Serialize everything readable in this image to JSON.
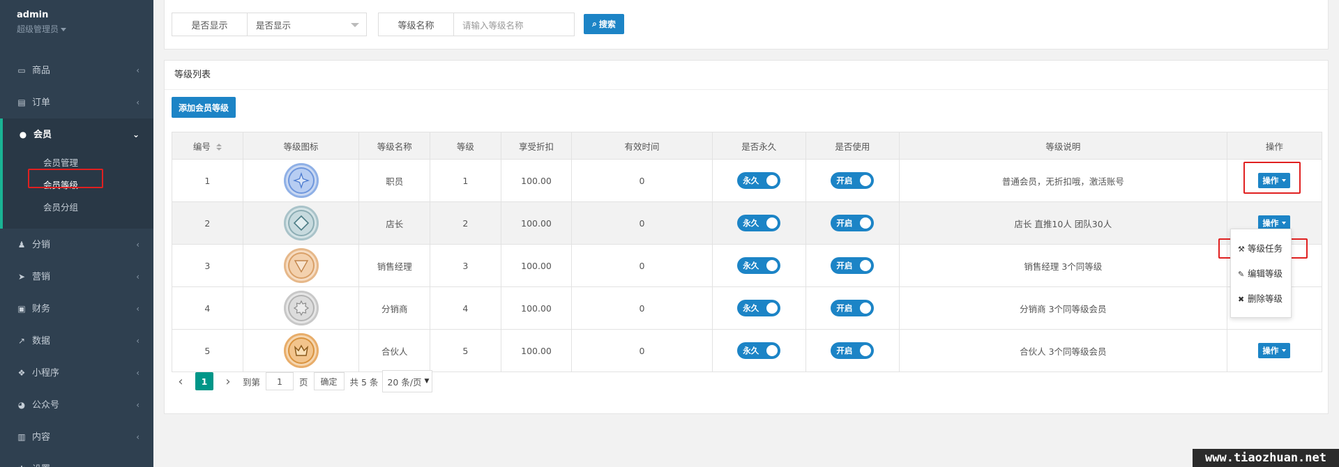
{
  "user": {
    "name": "admin",
    "role": "超级管理员"
  },
  "sidebar": {
    "items": [
      {
        "icon": "laptop-icon",
        "glyph": "▭",
        "label": "商品"
      },
      {
        "icon": "document-icon",
        "glyph": "▤",
        "label": "订单"
      },
      {
        "icon": "user-icon",
        "glyph": "●",
        "label": "会员",
        "active": true
      },
      {
        "icon": "users-icon",
        "glyph": "♟",
        "label": "分销"
      },
      {
        "icon": "paper-plane-icon",
        "glyph": "➤",
        "label": "营销"
      },
      {
        "icon": "money-icon",
        "glyph": "▣",
        "label": "财务"
      },
      {
        "icon": "line-chart-icon",
        "glyph": "↗",
        "label": "数据"
      },
      {
        "icon": "cubes-icon",
        "glyph": "❖",
        "label": "小程序"
      },
      {
        "icon": "wechat-icon",
        "glyph": "◕",
        "label": "公众号"
      },
      {
        "icon": "book-icon",
        "glyph": "▥",
        "label": "内容"
      },
      {
        "icon": "gear-icon",
        "glyph": "✱",
        "label": "设置"
      }
    ],
    "sub_items": [
      "会员管理",
      "会员等级",
      "会员分组"
    ]
  },
  "filters": {
    "display_label": "是否显示",
    "display_value": "是否显示",
    "name_label": "等级名称",
    "name_placeholder": "请输入等级名称",
    "search_label": "搜索"
  },
  "list": {
    "title": "等级列表",
    "add_label": "添加会员等级",
    "columns": [
      "编号",
      "等级图标",
      "等级名称",
      "等级",
      "享受折扣",
      "有效时间",
      "是否永久",
      "是否使用",
      "等级说明",
      "操作"
    ],
    "rows": [
      {
        "id": "1",
        "icon": "star-badge-icon",
        "name": "职员",
        "level": "1",
        "discount": "100.00",
        "valid": "0",
        "permanent": "永久",
        "enabled": "开启",
        "desc": "普通会员，无折扣哦，激活账号",
        "op": "操作"
      },
      {
        "id": "2",
        "icon": "diamond-badge-icon",
        "name": "店长",
        "level": "2",
        "discount": "100.00",
        "valid": "0",
        "permanent": "永久",
        "enabled": "开启",
        "desc": "店长 直推10人 团队30人",
        "op": "操作"
      },
      {
        "id": "3",
        "icon": "triangle-badge-icon",
        "name": "销售经理",
        "level": "3",
        "discount": "100.00",
        "valid": "0",
        "permanent": "永久",
        "enabled": "开启",
        "desc": "销售经理 3个同等级",
        "op": ""
      },
      {
        "id": "4",
        "icon": "gear-badge-icon",
        "name": "分销商",
        "level": "4",
        "discount": "100.00",
        "valid": "0",
        "permanent": "永久",
        "enabled": "开启",
        "desc": "分销商 3个同等级会员",
        "op": ""
      },
      {
        "id": "5",
        "icon": "crown-badge-icon",
        "name": "合伙人",
        "level": "5",
        "discount": "100.00",
        "valid": "0",
        "permanent": "永久",
        "enabled": "开启",
        "desc": "合伙人 3个同等级会员",
        "op": "操作"
      }
    ]
  },
  "dropdown": {
    "items": [
      {
        "icon": "wrench-icon",
        "glyph": "🔧",
        "label": "等级任务"
      },
      {
        "icon": "edit-icon",
        "glyph": "✎",
        "label": "编辑等级"
      },
      {
        "icon": "close-icon",
        "glyph": "✖",
        "label": "删除等级"
      }
    ]
  },
  "pager": {
    "current": "1",
    "goto_label": "到第",
    "goto_value": "1",
    "page_unit": "页",
    "confirm_label": "确定",
    "total_label": "共 5 条",
    "page_size": "20 条/页"
  },
  "watermark": "www.tiaozhuan.net",
  "colors": {
    "sidebar_bg": "#2f4050",
    "accent_blue": "#1c84c6",
    "accent_green": "#1ab394",
    "pager_teal": "#009688",
    "highlight_red": "#e02020"
  }
}
